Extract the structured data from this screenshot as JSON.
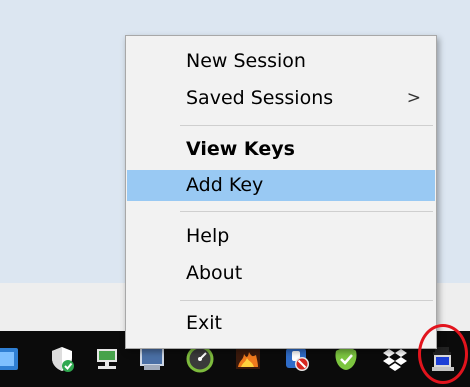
{
  "context_menu": {
    "items": [
      {
        "label": "New Session"
      },
      {
        "label": "Saved Sessions",
        "submenu_indicator": ">"
      },
      {
        "label": "View Keys",
        "bold": true
      },
      {
        "label": "Add Key",
        "highlighted": true
      },
      {
        "label": "Help"
      },
      {
        "label": "About"
      },
      {
        "label": "Exit"
      }
    ]
  },
  "taskbar": {
    "tray_icons": [
      "blue-app-icon",
      "windows-security-icon",
      "network-icon",
      "display-icon",
      "speed-gauge-icon",
      "fire-icon",
      "blocked-app-icon",
      "green-check-icon",
      "dropbox-icon",
      "pageant-icon"
    ]
  },
  "colors": {
    "menu_background": "#f2f2f2",
    "highlight": "#99c9f3",
    "taskbar": "#0b0b0b",
    "annotation_circle": "#e2141d"
  }
}
